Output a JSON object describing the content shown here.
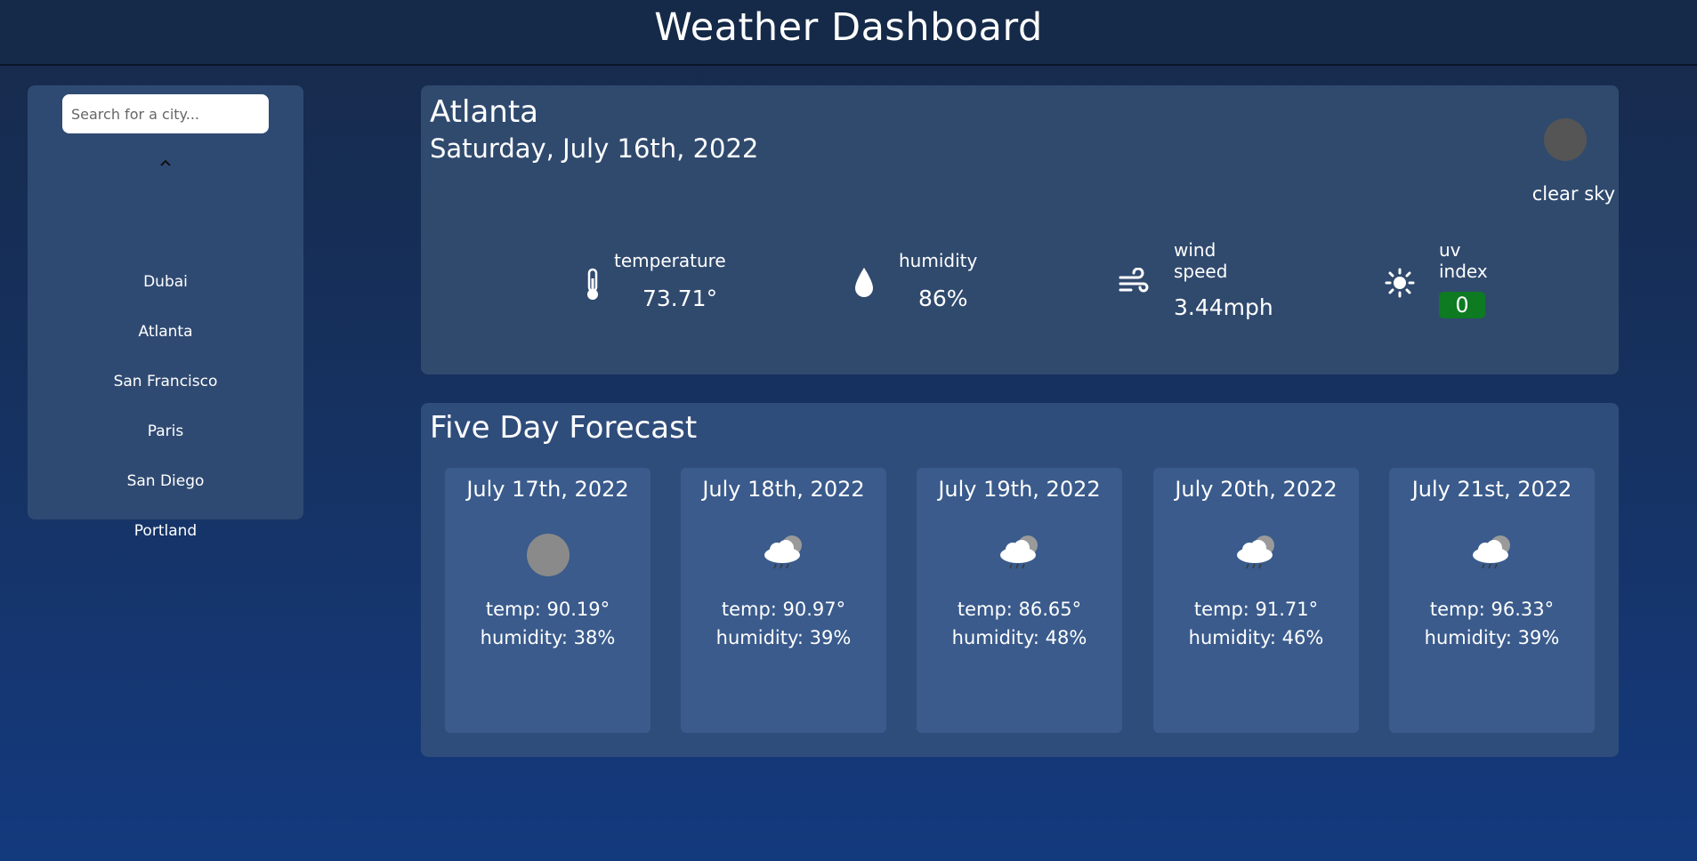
{
  "header": {
    "title": "Weather Dashboard"
  },
  "sidebar": {
    "search_placeholder": "Search for a city...",
    "cities": [
      "Dubai",
      "Atlanta",
      "San Francisco",
      "Paris",
      "San Diego",
      "Portland"
    ]
  },
  "current": {
    "city": "Atlanta",
    "date": "Saturday, July 16th, 2022",
    "condition": "clear sky",
    "condition_icon": "circle-icon",
    "temperature": {
      "label": "temperature",
      "value": "73.71°",
      "icon": "thermometer-icon"
    },
    "humidity": {
      "label": "humidity",
      "value": "86%",
      "icon": "droplet-icon"
    },
    "wind": {
      "label_1": "wind",
      "label_2": "speed",
      "value": "3.44mph",
      "icon": "wind-icon"
    },
    "uv": {
      "label_1": "uv",
      "label_2": "index",
      "value": "0",
      "icon": "sun-icon",
      "badge_color": "#0e7a22"
    }
  },
  "forecast": {
    "title": "Five Day Forecast",
    "days": [
      {
        "date": "July 17th, 2022",
        "temp": "temp: 90.19°",
        "humidity": "humidity: 38%",
        "icon": "circle-icon"
      },
      {
        "date": "July 18th, 2022",
        "temp": "temp: 90.97°",
        "humidity": "humidity: 39%",
        "icon": "rain-cloud-icon"
      },
      {
        "date": "July 19th, 2022",
        "temp": "temp: 86.65°",
        "humidity": "humidity: 48%",
        "icon": "rain-cloud-icon"
      },
      {
        "date": "July 20th, 2022",
        "temp": "temp: 91.71°",
        "humidity": "humidity: 46%",
        "icon": "rain-cloud-icon"
      },
      {
        "date": "July 21st, 2022",
        "temp": "temp: 96.33°",
        "humidity": "humidity: 39%",
        "icon": "rain-cloud-icon"
      }
    ]
  }
}
